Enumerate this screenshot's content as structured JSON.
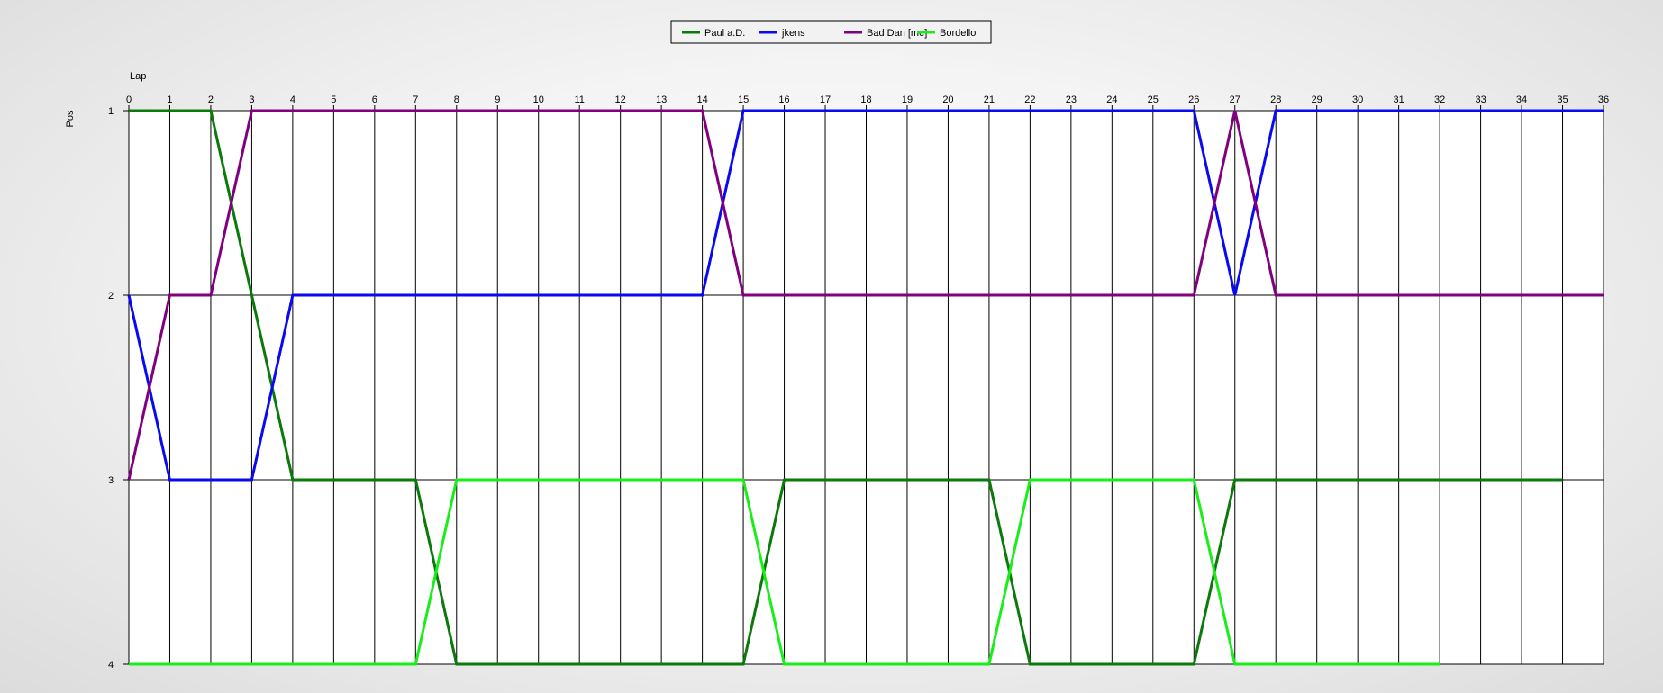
{
  "chart_data": {
    "type": "line",
    "xlabel": "Lap",
    "ylabel": "Pos",
    "x": [
      0,
      1,
      2,
      3,
      4,
      5,
      6,
      7,
      8,
      9,
      10,
      11,
      12,
      13,
      14,
      15,
      16,
      17,
      18,
      19,
      20,
      21,
      22,
      23,
      24,
      25,
      26,
      27,
      28,
      29,
      30,
      31,
      32,
      33,
      34,
      35,
      36
    ],
    "xlim": [
      0,
      36
    ],
    "y_ticks": [
      1,
      2,
      3,
      4
    ],
    "ylim": [
      1,
      4
    ],
    "y_inverted": true,
    "grid": true,
    "legend_position": "top-center",
    "series": [
      {
        "name": "Paul a.D.",
        "color": "#0a7a0a",
        "values": [
          1,
          1,
          1,
          2,
          3,
          3,
          3,
          3,
          4,
          4,
          4,
          4,
          4,
          4,
          4,
          4,
          3,
          3,
          3,
          3,
          3,
          3,
          4,
          4,
          4,
          4,
          4,
          3,
          3,
          3,
          3,
          3,
          3,
          3,
          3,
          3
        ]
      },
      {
        "name": "jkens",
        "color": "#0a0af0",
        "values": [
          2,
          3,
          3,
          3,
          2,
          2,
          2,
          2,
          2,
          2,
          2,
          2,
          2,
          2,
          2,
          1,
          1,
          1,
          1,
          1,
          1,
          1,
          1,
          1,
          1,
          1,
          1,
          2,
          1,
          1,
          1,
          1,
          1,
          1,
          1,
          1,
          1
        ]
      },
      {
        "name": "Bad Dan [me]",
        "color": "#800080",
        "values": [
          3,
          2,
          2,
          1,
          1,
          1,
          1,
          1,
          1,
          1,
          1,
          1,
          1,
          1,
          1,
          2,
          2,
          2,
          2,
          2,
          2,
          2,
          2,
          2,
          2,
          2,
          2,
          1,
          2,
          2,
          2,
          2,
          2,
          2,
          2,
          2,
          2
        ]
      },
      {
        "name": "Bordello",
        "color": "#1aee1a",
        "values": [
          4,
          4,
          4,
          4,
          4,
          4,
          4,
          4,
          3,
          3,
          3,
          3,
          3,
          3,
          3,
          3,
          4,
          4,
          4,
          4,
          4,
          4,
          3,
          3,
          3,
          3,
          3,
          4,
          4,
          4,
          4,
          4,
          4
        ]
      }
    ]
  }
}
